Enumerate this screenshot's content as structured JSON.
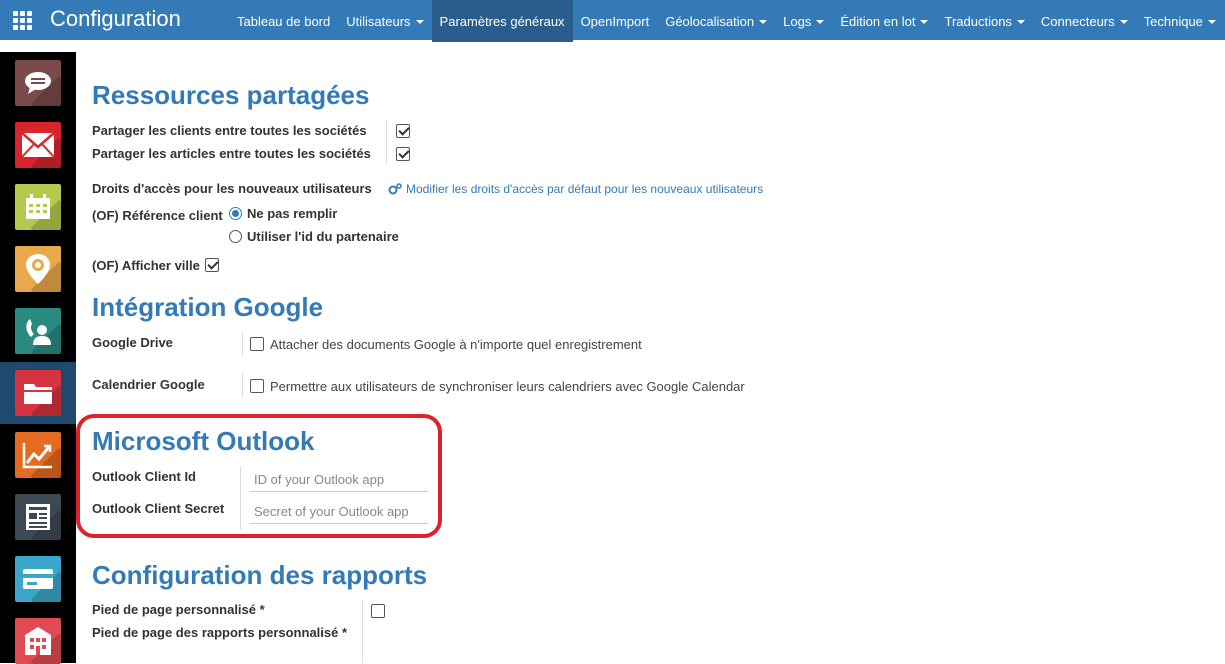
{
  "header": {
    "title": "Configuration",
    "nav": [
      {
        "label": "Tableau de bord",
        "dropdown": false,
        "active": false
      },
      {
        "label": "Utilisateurs",
        "dropdown": true,
        "active": false
      },
      {
        "label": "Paramètres généraux",
        "dropdown": false,
        "active": true
      },
      {
        "label": "OpenImport",
        "dropdown": false,
        "active": false
      },
      {
        "label": "Géolocalisation",
        "dropdown": true,
        "active": false
      },
      {
        "label": "Logs",
        "dropdown": true,
        "active": false
      },
      {
        "label": "Édition en lot",
        "dropdown": true,
        "active": false
      },
      {
        "label": "Traductions",
        "dropdown": true,
        "active": false
      },
      {
        "label": "Connecteurs",
        "dropdown": true,
        "active": false
      },
      {
        "label": "Technique",
        "dropdown": true,
        "active": false
      }
    ]
  },
  "sidebar": {
    "apps": [
      {
        "icon": "chat-icon",
        "color": "#7b4a4a"
      },
      {
        "icon": "mail-icon",
        "color": "#d9242c"
      },
      {
        "icon": "calendar-icon",
        "color": "#b6c94a"
      },
      {
        "icon": "location-gear-icon",
        "color": "#e9a94b"
      },
      {
        "icon": "contact-phone-icon",
        "color": "#2a8a82"
      },
      {
        "icon": "folder-icon",
        "color": "#d6323f"
      },
      {
        "icon": "chart-up-icon",
        "color": "#e56a22"
      },
      {
        "icon": "document-icon",
        "color": "#3d4a56"
      },
      {
        "icon": "card-icon",
        "color": "#3aa6c9"
      },
      {
        "icon": "building-icon",
        "color": "#e04a52"
      }
    ]
  },
  "shared": {
    "title": "Ressources partagées",
    "share_clients": "Partager les clients entre toutes les sociétés",
    "share_articles": "Partager les articles entre toutes les sociétés",
    "access_rights": "Droits d'accès pour les nouveaux utilisateurs",
    "access_link": "Modifier les droits d'accès par défaut pour les nouveaux utilisateurs",
    "client_ref": "(OF) Référence client",
    "radio_none": "Ne pas remplir",
    "radio_partner": "Utiliser l'id du partenaire",
    "show_city": "(OF) Afficher ville"
  },
  "google": {
    "title": "Intégration Google",
    "drive_label": "Google Drive",
    "drive_text": "Attacher des documents Google à n'importe quel enregistrement",
    "calendar_label": "Calendrier Google",
    "calendar_text": "Permettre aux utilisateurs de synchroniser leurs calendriers avec Google Calendar"
  },
  "outlook": {
    "title": "Microsoft Outlook",
    "client_id_label": "Outlook Client Id",
    "client_id_placeholder": "ID of your Outlook app",
    "client_secret_label": "Outlook Client Secret",
    "client_secret_placeholder": "Secret of your Outlook app"
  },
  "reports": {
    "title": "Configuration des rapports",
    "custom_footer": "Pied de page personnalisé *",
    "custom_report_footer": "Pied de page des rapports personnalisé *"
  }
}
